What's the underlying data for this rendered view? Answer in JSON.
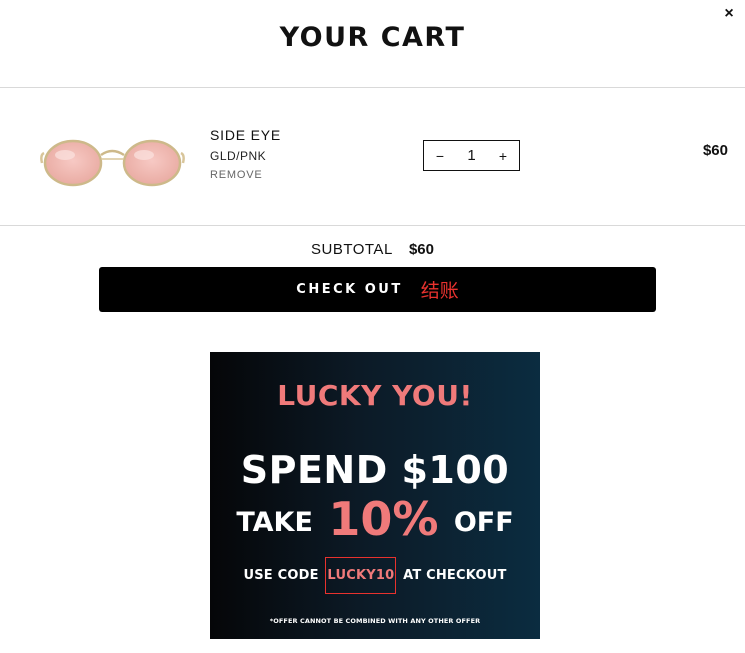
{
  "close_label": "×",
  "title": "YOUR CART",
  "item": {
    "name": "SIDE EYE",
    "variant": "GLD/PNK",
    "remove_label": "REMOVE",
    "quantity": "1",
    "decrement_label": "−",
    "increment_label": "+",
    "price": "$60"
  },
  "subtotal": {
    "label": "SUBTOTAL",
    "amount": "$60"
  },
  "checkout": {
    "label": "CHECK OUT",
    "annotation": "结账"
  },
  "promo": {
    "headline": "LUCKY YOU!",
    "spend": "SPEND $100",
    "take_prefix": "TAKE",
    "discount": "10%",
    "take_suffix": "OFF",
    "code_prefix": "USE CODE",
    "code": "LUCKY10",
    "code_suffix": "AT CHECKOUT",
    "fine_print": "*OFFER CANNOT BE COMBINED WITH ANY OTHER OFFER"
  },
  "colors": {
    "accent_pink": "#f07a7a",
    "annotation_red": "#e8322e",
    "button_black": "#000000"
  }
}
